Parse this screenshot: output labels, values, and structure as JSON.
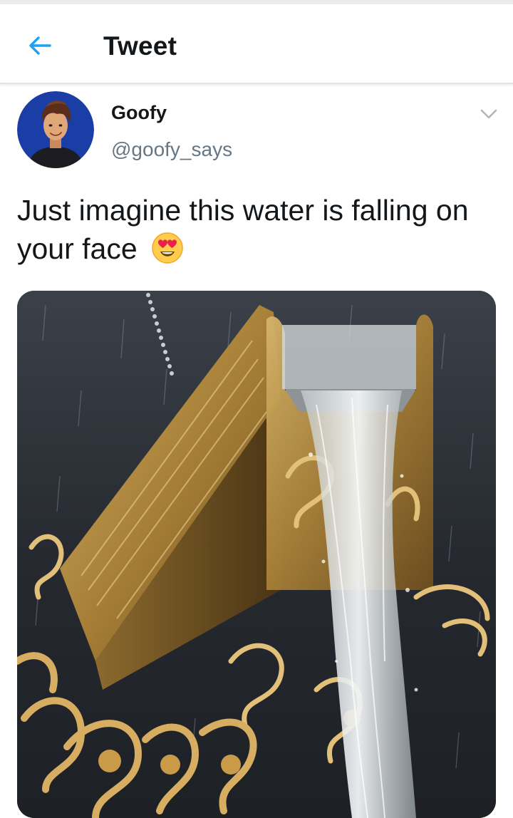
{
  "header": {
    "title": "Tweet",
    "back_icon": "arrow-left-icon"
  },
  "tweet": {
    "author_name": "Goofy",
    "author_handle": "@goofy_says",
    "text": "Just imagine this water is falling on your face",
    "emoji": "heart-eyes-face",
    "more_icon": "chevron-down-icon"
  },
  "colors": {
    "accent": "#1da1f2",
    "text_primary": "#14171a",
    "text_secondary": "#657786",
    "divider": "#e1e4e6"
  }
}
